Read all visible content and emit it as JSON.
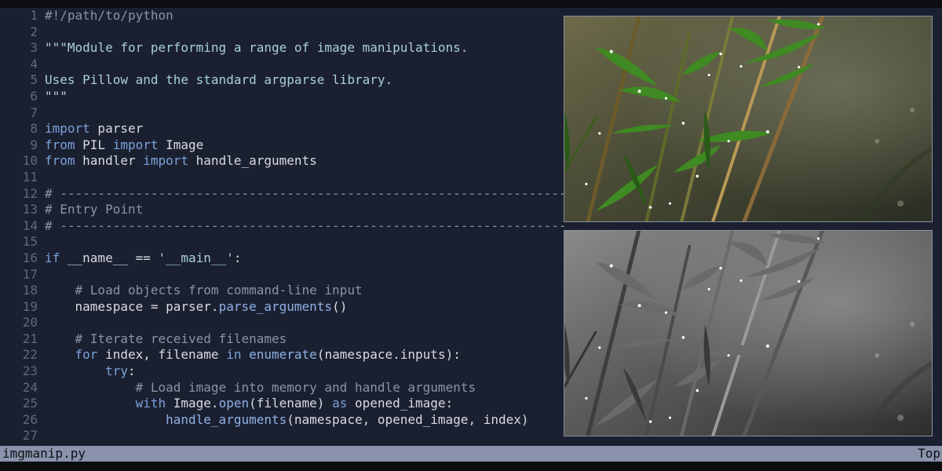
{
  "editor": {
    "lines": [
      {
        "number": "1",
        "tokens": [
          {
            "text": "#!/path/to/python",
            "kind": "comment"
          }
        ]
      },
      {
        "number": "2",
        "tokens": []
      },
      {
        "number": "3",
        "tokens": [
          {
            "text": "\"\"\"Module for performing a range of image manipulations.",
            "kind": "string"
          }
        ]
      },
      {
        "number": "4",
        "tokens": []
      },
      {
        "number": "5",
        "tokens": [
          {
            "text": "Uses Pillow and the standard argparse library.",
            "kind": "string"
          }
        ]
      },
      {
        "number": "6",
        "tokens": [
          {
            "text": "\"\"\"",
            "kind": "string"
          }
        ]
      },
      {
        "number": "7",
        "tokens": []
      },
      {
        "number": "8",
        "tokens": [
          {
            "text": "import",
            "kind": "keyword"
          },
          {
            "text": " parser",
            "kind": "plain"
          }
        ]
      },
      {
        "number": "9",
        "tokens": [
          {
            "text": "from",
            "kind": "keyword"
          },
          {
            "text": " PIL ",
            "kind": "plain"
          },
          {
            "text": "import",
            "kind": "keyword"
          },
          {
            "text": " Image",
            "kind": "plain"
          }
        ]
      },
      {
        "number": "10",
        "tokens": [
          {
            "text": "from",
            "kind": "keyword"
          },
          {
            "text": " handler ",
            "kind": "plain"
          },
          {
            "text": "import",
            "kind": "keyword"
          },
          {
            "text": " handle_arguments",
            "kind": "plain"
          }
        ]
      },
      {
        "number": "11",
        "tokens": []
      },
      {
        "number": "12",
        "tokens": [
          {
            "text": "# -------------------------------------------------------------------",
            "kind": "comment"
          }
        ]
      },
      {
        "number": "13",
        "tokens": [
          {
            "text": "# Entry Point",
            "kind": "comment"
          }
        ]
      },
      {
        "number": "14",
        "tokens": [
          {
            "text": "# -------------------------------------------------------------------",
            "kind": "comment"
          }
        ]
      },
      {
        "number": "15",
        "tokens": []
      },
      {
        "number": "16",
        "tokens": [
          {
            "text": "if",
            "kind": "keyword"
          },
          {
            "text": " __name__ == ",
            "kind": "plain"
          },
          {
            "text": "'__main__'",
            "kind": "string"
          },
          {
            "text": ":",
            "kind": "plain"
          }
        ]
      },
      {
        "number": "17",
        "tokens": []
      },
      {
        "number": "18",
        "tokens": [
          {
            "text": "    # Load objects from command-line input",
            "kind": "comment"
          }
        ]
      },
      {
        "number": "19",
        "tokens": [
          {
            "text": "    namespace = parser.",
            "kind": "plain"
          },
          {
            "text": "parse_arguments",
            "kind": "func"
          },
          {
            "text": "()",
            "kind": "plain"
          }
        ]
      },
      {
        "number": "20",
        "tokens": []
      },
      {
        "number": "21",
        "tokens": [
          {
            "text": "    # Iterate received filenames",
            "kind": "comment"
          }
        ]
      },
      {
        "number": "22",
        "tokens": [
          {
            "text": "    ",
            "kind": "plain"
          },
          {
            "text": "for",
            "kind": "keyword"
          },
          {
            "text": " index, filename ",
            "kind": "plain"
          },
          {
            "text": "in",
            "kind": "keyword"
          },
          {
            "text": " ",
            "kind": "plain"
          },
          {
            "text": "enumerate",
            "kind": "func"
          },
          {
            "text": "(namespace.inputs):",
            "kind": "plain"
          }
        ]
      },
      {
        "number": "23",
        "tokens": [
          {
            "text": "        ",
            "kind": "plain"
          },
          {
            "text": "try",
            "kind": "keyword"
          },
          {
            "text": ":",
            "kind": "plain"
          }
        ]
      },
      {
        "number": "24",
        "tokens": [
          {
            "text": "            # Load image into memory and handle arguments",
            "kind": "comment"
          }
        ]
      },
      {
        "number": "25",
        "tokens": [
          {
            "text": "            ",
            "kind": "plain"
          },
          {
            "text": "with",
            "kind": "keyword"
          },
          {
            "text": " Image.",
            "kind": "plain"
          },
          {
            "text": "open",
            "kind": "func"
          },
          {
            "text": "(filename) ",
            "kind": "plain"
          },
          {
            "text": "as",
            "kind": "keyword"
          },
          {
            "text": " opened_image:",
            "kind": "plain"
          }
        ]
      },
      {
        "number": "26",
        "tokens": [
          {
            "text": "                ",
            "kind": "plain"
          },
          {
            "text": "handle_arguments",
            "kind": "func"
          },
          {
            "text": "(namespace, opened_image, index)",
            "kind": "plain"
          }
        ]
      },
      {
        "number": "27",
        "tokens": []
      }
    ]
  },
  "images": [
    {
      "name": "bamboo-leaves-color-photo",
      "style": "color"
    },
    {
      "name": "bamboo-leaves-grayscale-photo",
      "style": "grayscale"
    }
  ],
  "status": {
    "filename": "imgmanip.py",
    "position": "Top"
  },
  "colors": {
    "editor_background": "#1b2031",
    "keyword": "#7aa2da",
    "string": "#a8d0d8",
    "comment": "#8a93a6",
    "function": "#8fb0e6",
    "line_number": "#5d6982",
    "status_background": "#8a93ab"
  }
}
